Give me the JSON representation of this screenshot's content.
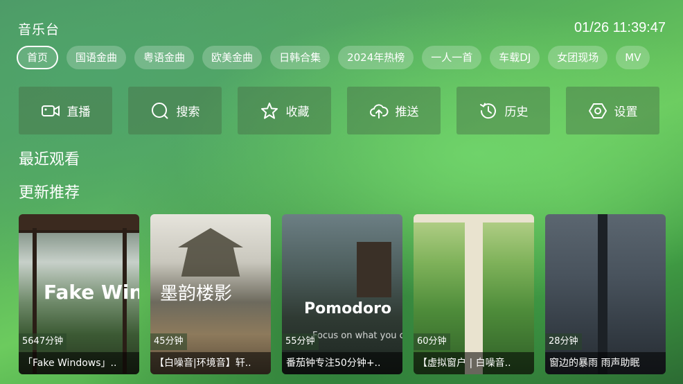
{
  "header": {
    "title": "音乐台",
    "clock": "01/26 11:39:47"
  },
  "tabs": [
    "首页",
    "国语金曲",
    "粤语金曲",
    "欧美金曲",
    "日韩合集",
    "2024年热榜",
    "一人一首",
    "车载DJ",
    "女团现场",
    "MV"
  ],
  "actions": [
    {
      "label": "直播",
      "icon": "video-camera-icon"
    },
    {
      "label": "搜索",
      "icon": "search-icon"
    },
    {
      "label": "收藏",
      "icon": "star-icon"
    },
    {
      "label": "推送",
      "icon": "cloud-upload-icon"
    },
    {
      "label": "历史",
      "icon": "history-icon"
    },
    {
      "label": "设置",
      "icon": "settings-icon"
    }
  ],
  "sections": {
    "recent": "最近观看",
    "updates": "更新推荐"
  },
  "cards": [
    {
      "duration": "5647分钟",
      "title": "「Fake Windows」..",
      "thumb_text": "Fake Windo"
    },
    {
      "duration": "45分钟",
      "title": "【白噪音|环境音】轩..",
      "thumb_text": "墨韵楼影"
    },
    {
      "duration": "55分钟",
      "title": "番茄钟专注50分钟+..",
      "thumb_text": "Pomodoro",
      "thumb_subtext": "Focus on what you can achieve"
    },
    {
      "duration": "60分钟",
      "title": "【虚拟窗户 | 白噪音..",
      "thumb_text": ""
    },
    {
      "duration": "28分钟",
      "title": "窗边的暴雨 雨声助眠",
      "thumb_text": ""
    }
  ]
}
